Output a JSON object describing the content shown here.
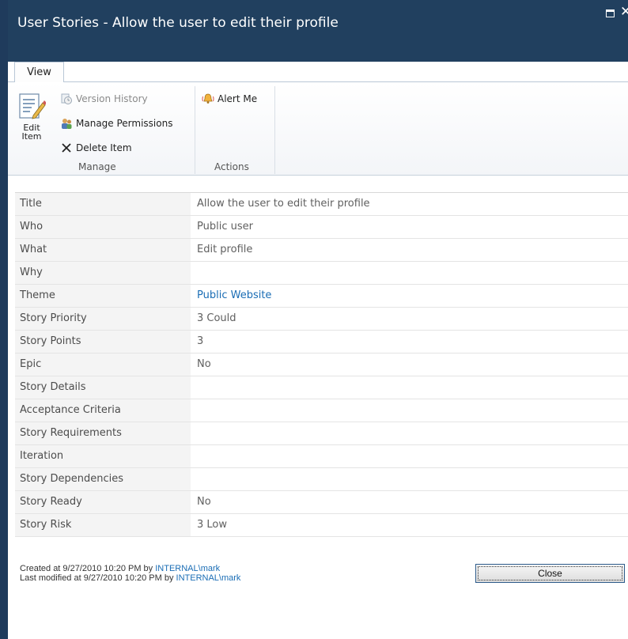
{
  "window": {
    "title": "User Stories - Allow the user to edit their profile"
  },
  "tabs": [
    {
      "label": "View"
    }
  ],
  "ribbon": {
    "manage": {
      "group_label": "Manage",
      "edit_item_line1": "Edit",
      "edit_item_line2": "Item",
      "version_history": "Version History",
      "manage_permissions": "Manage Permissions",
      "delete_item": "Delete Item"
    },
    "actions": {
      "group_label": "Actions",
      "alert_me": "Alert Me"
    }
  },
  "fields": [
    {
      "label": "Title",
      "value": "Allow the user to edit their profile"
    },
    {
      "label": "Who",
      "value": "Public user"
    },
    {
      "label": "What",
      "value": "Edit profile"
    },
    {
      "label": "Why",
      "value": ""
    },
    {
      "label": "Theme",
      "value": "Public Website",
      "link": true
    },
    {
      "label": "Story Priority",
      "value": "3 Could"
    },
    {
      "label": "Story Points",
      "value": "3"
    },
    {
      "label": "Epic",
      "value": "No"
    },
    {
      "label": "Story Details",
      "value": ""
    },
    {
      "label": "Acceptance Criteria",
      "value": ""
    },
    {
      "label": "Story Requirements",
      "value": ""
    },
    {
      "label": "Iteration",
      "value": ""
    },
    {
      "label": "Story Dependencies",
      "value": ""
    },
    {
      "label": "Story Ready",
      "value": "No"
    },
    {
      "label": "Story Risk",
      "value": "3 Low"
    }
  ],
  "footer": {
    "created_prefix": "Created at 9/27/2010 10:20 PM by ",
    "created_by": "INTERNAL\\mark",
    "modified_prefix": "Last modified at 9/27/2010 10:20 PM by ",
    "modified_by": "INTERNAL\\mark",
    "close_label": "Close"
  },
  "colors": {
    "titlebar": "#21405f",
    "link": "#1a6db5"
  }
}
